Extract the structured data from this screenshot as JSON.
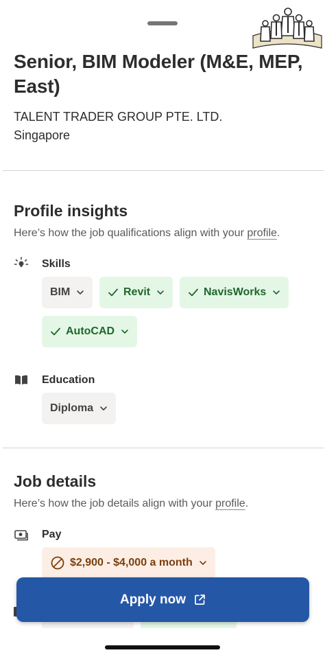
{
  "header": {
    "job_title": "Senior, BIM Modeler (M&E, MEP, East)",
    "company": "TALENT TRADER GROUP PTE. LTD.",
    "location": "Singapore"
  },
  "profile_insights": {
    "title": "Profile insights",
    "subtitle_prefix": "Here’s how the job qualifications align with your ",
    "subtitle_link": "profile",
    "subtitle_suffix": ".",
    "skills": {
      "label": "Skills",
      "icon": "lightbulb-icon",
      "items": [
        {
          "label": "BIM",
          "matched": false
        },
        {
          "label": "Revit",
          "matched": true
        },
        {
          "label": "NavisWorks",
          "matched": true
        },
        {
          "label": "AutoCAD",
          "matched": true
        }
      ]
    },
    "education": {
      "label": "Education",
      "icon": "book-icon",
      "items": [
        {
          "label": "Diploma",
          "matched": false
        }
      ]
    }
  },
  "job_details": {
    "title": "Job details",
    "subtitle_prefix": "Here’s how the job details align with your ",
    "subtitle_link": "profile",
    "subtitle_suffix": ".",
    "pay": {
      "label": "Pay",
      "icon": "money-icon",
      "value": "$2,900 - $4,000 a month",
      "status": "mismatch"
    }
  },
  "apply": {
    "label": "Apply now",
    "icon": "external-link-icon"
  },
  "colors": {
    "primary": "#2557a7",
    "match_bg": "#e4f7e6",
    "match_text": "#1f662c",
    "mismatch_bg": "#fdeee5",
    "mismatch_text": "#7a3f0d",
    "neutral_bg": "#f3f2f1"
  }
}
